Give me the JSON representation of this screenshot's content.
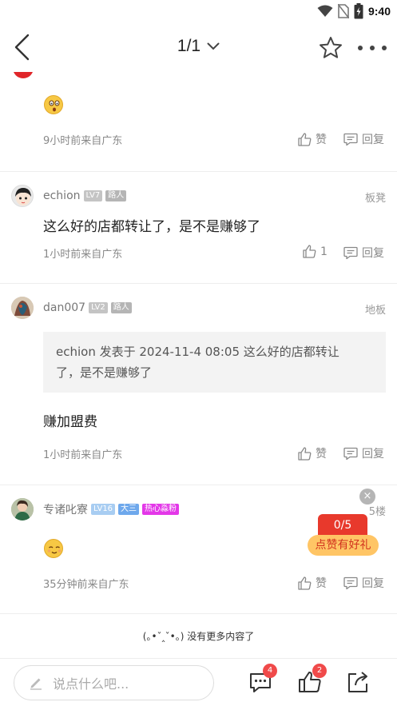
{
  "status_bar": {
    "time": "9:40"
  },
  "nav": {
    "page_indicator": "1/1"
  },
  "comments": [
    {
      "time_location": "9小时前来自广东",
      "like_label": "赞",
      "reply_label": "回复"
    },
    {
      "username": "echion",
      "level": "LV7",
      "tag": "路人",
      "floor": "板凳",
      "text": "这么好的店都转让了，是不是赚够了",
      "time_location": "1小时前来自广东",
      "like_count": "1",
      "reply_label": "回复"
    },
    {
      "username": "dan007",
      "level": "LV2",
      "tag": "路人",
      "floor": "地板",
      "quote_line1": "echion 发表于 2024-11-4 08:05 这么好的店都转让",
      "quote_line2": "了，是不是赚够了",
      "text": "赚加盟费",
      "time_location": "1小时前来自广东",
      "like_label": "赞",
      "reply_label": "回复"
    },
    {
      "username": "专诸叱寮",
      "level": "LV16",
      "tag": "大三",
      "tag2": "热心淼粉",
      "floor": "5楼",
      "time_location": "35分钟前来自广东",
      "like_label": "赞",
      "reply_label": "回复"
    }
  ],
  "end_text": "(｡•ˇ‸ˇ•｡) 没有更多内容了",
  "promo": {
    "close": "×",
    "count": "0/5",
    "label": "点赞有好礼"
  },
  "bottom_bar": {
    "placeholder": "说点什么吧...",
    "comment_count": "4",
    "like_count": "2"
  },
  "colors": {
    "badge_gray": "#c4c4c4",
    "badge_blue": "#8ec0f0",
    "badge_magenta": "#e337e8",
    "accent_red": "#e8392c"
  },
  "icons": [
    "wifi-icon",
    "no-sim-icon",
    "battery-icon",
    "back-arrow-icon",
    "chevron-down-icon",
    "star-icon",
    "more-icon",
    "thumb-up-icon",
    "reply-icon",
    "edit-icon",
    "comment-icon",
    "share-icon"
  ]
}
